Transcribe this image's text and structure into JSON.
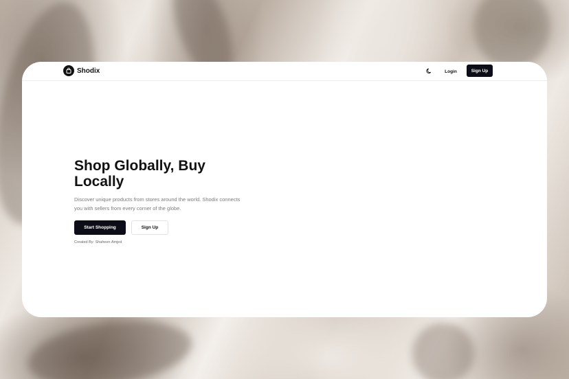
{
  "brand": {
    "name": "Shodix",
    "logo_icon": "shopping-bag-icon"
  },
  "nav": {
    "theme_icon": "moon-icon",
    "login_label": "Login",
    "signup_label": "Sign Up"
  },
  "hero": {
    "title": "Shop Globally, Buy Locally",
    "description": "Discover unique products from stores around the world. Shodix connects you with sellers from every corner of the globe.",
    "primary_cta": "Start Shopping",
    "secondary_cta": "Sign Up",
    "credit": "Created By: Shaheen Amjed"
  },
  "colors": {
    "primary": "#0d0d17",
    "background_card": "#ffffff",
    "muted_text": "#7a7a7a"
  }
}
